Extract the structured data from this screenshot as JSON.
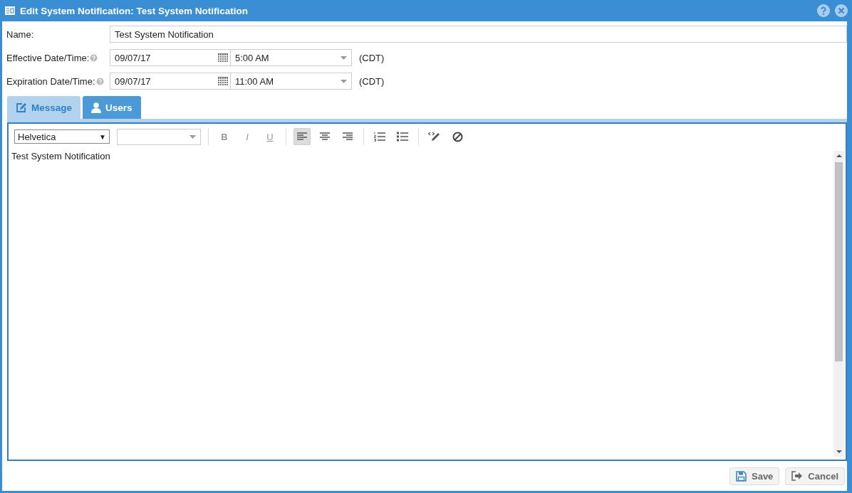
{
  "window": {
    "title": "Edit System Notification: Test System Notification"
  },
  "fields": [
    {
      "kind": "text",
      "label": "Name:",
      "help": false,
      "value": "Test System Notification"
    },
    {
      "kind": "datetime",
      "label": "Effective Date/Time:",
      "help": true,
      "date": "09/07/17",
      "time": "5:00 AM",
      "zone": "(CDT)"
    },
    {
      "kind": "datetime",
      "label": "Expiration Date/Time:",
      "help": true,
      "date": "09/07/17",
      "time": "11:00 AM",
      "zone": "(CDT)"
    }
  ],
  "tabs": [
    {
      "label": "Message",
      "kind": "edit",
      "selected": true
    },
    {
      "label": "Users",
      "kind": "user",
      "selected": false
    }
  ],
  "editor": {
    "font": "Helvetica",
    "font_arrow": "▼",
    "toolbar": [
      [
        {
          "kind": "bold",
          "label": "B",
          "active": false
        },
        {
          "kind": "italic",
          "label": "I",
          "active": false
        },
        {
          "kind": "underline",
          "label": "U",
          "active": false
        }
      ],
      [
        {
          "kind": "align-left",
          "active": true
        },
        {
          "kind": "align-center",
          "active": false
        },
        {
          "kind": "align-right",
          "active": false
        }
      ],
      [
        {
          "kind": "ordered-list",
          "active": false
        },
        {
          "kind": "bullet-list",
          "active": false
        }
      ],
      [
        {
          "kind": "html",
          "active": false
        },
        {
          "kind": "clear",
          "active": false
        }
      ]
    ],
    "content": "Test System Notification"
  },
  "buttons": [
    {
      "kind": "save",
      "label": "Save"
    },
    {
      "kind": "cancel",
      "label": "Cancel"
    }
  ]
}
